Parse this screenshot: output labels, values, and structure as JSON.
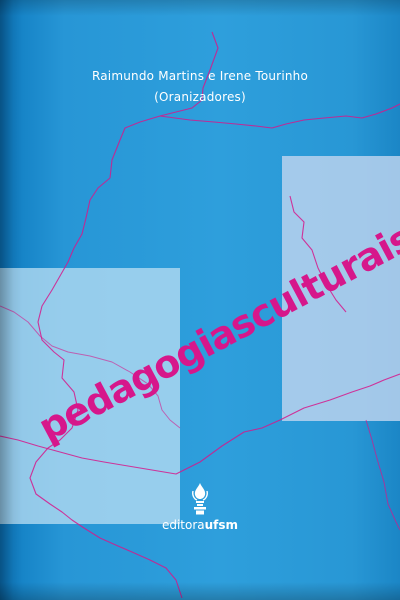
{
  "authors_line": "Raimundo Martins e Irene Tourinho",
  "role_line": "(Oranizadores)",
  "title": "pedagogiasculturais",
  "publisher": {
    "prefix": "editora",
    "name": "ufsm"
  },
  "colors": {
    "background": "#2e9fdc",
    "title": "#d6178b",
    "line": "#d6178b",
    "left_panel": "#b6dcf2",
    "right_panel": "#b8d2ee"
  },
  "icons": {
    "publisher_logo": "lamp-flame-icon"
  }
}
